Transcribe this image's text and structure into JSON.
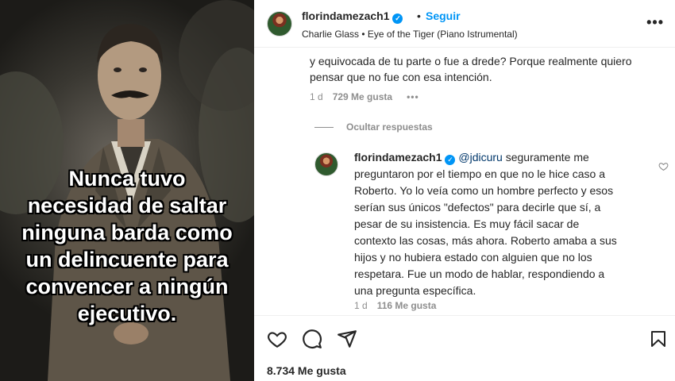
{
  "media": {
    "overlay_text": "Nunca tuvo\nnecesidad de saltar\nninguna barda como\nun delincuente para\nconvencer a ningún\nejecutivo."
  },
  "header": {
    "username": "florindamezach1",
    "separator": "•",
    "follow_label": "Seguir",
    "audio": "Charlie Glass • Eye of the Tiger (Piano Istrumental)",
    "more_icon": "more-horizontal-icon"
  },
  "comment1": {
    "text": "y equivocada de tu parte o fue a drede? Porque realmente quiero pensar que no fue con esa intención.",
    "time": "1 d",
    "likes": "729 Me gusta",
    "more": "•••"
  },
  "hide_replies_label": "Ocultar respuestas",
  "reply": {
    "username": "florindamezach1",
    "mention": "@jdicuru",
    "text": " seguramente me preguntaron por el tiempo en que no le hice caso a Roberto. Yo lo veía como un hombre perfecto y esos serían sus únicos \"defectos\" para decirle que sí, a pesar de su insistencia. Es muy fácil sacar de contexto las cosas, más ahora. Roberto amaba a sus hijos y no hubiera estado con alguien que no los respetara. Fue un modo de hablar, respondiendo a una pregunta específica.",
    "time": "1 d",
    "likes": "116 Me gusta"
  },
  "actions": {
    "likes_count": "8.734 Me gusta",
    "icons": [
      "heart-icon",
      "comment-icon",
      "share-icon",
      "bookmark-icon"
    ]
  },
  "colors": {
    "accent": "#0095f6",
    "text": "#262626",
    "muted": "#8e8e8e",
    "mention": "#00376b"
  }
}
